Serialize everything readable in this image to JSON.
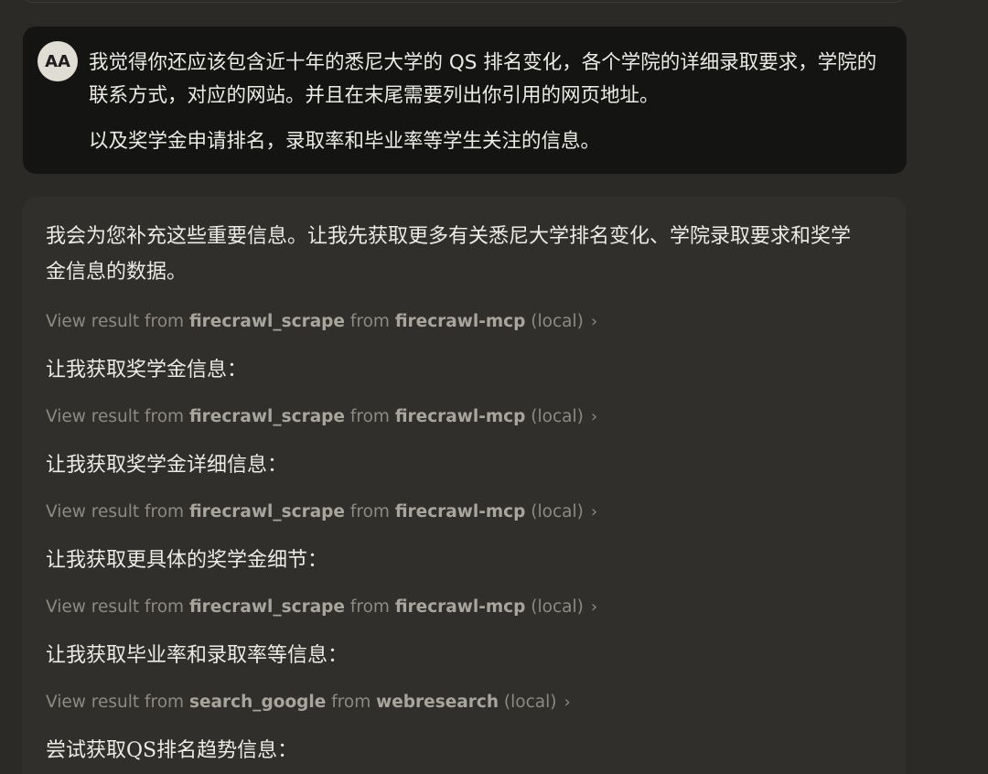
{
  "user_message": {
    "avatar_initials": "AA",
    "paragraphs": [
      "我觉得你还应该包含近十年的悉尼大学的 QS 排名变化，各个学院的详细录取要求，学院的联系方式，对应的网站。并且在末尾需要列出你引用的网页地址。",
      "以及奖学金申请排名，录取率和毕业率等学生关注的信息。"
    ]
  },
  "assistant_message": {
    "intro": "我会为您补充这些重要信息。让我先获取更多有关悉尼大学排名变化、学院录取要求和奖学金信息的数据。",
    "tool_result_prefix": "View result from",
    "tool_result_from": "from",
    "tool_result_suffix": "(local)",
    "steps": [
      {
        "tool": "firecrawl_scrape",
        "server": "firecrawl-mcp",
        "after_text": "让我获取奖学金信息："
      },
      {
        "tool": "firecrawl_scrape",
        "server": "firecrawl-mcp",
        "after_text": "让我获取奖学金详细信息："
      },
      {
        "tool": "firecrawl_scrape",
        "server": "firecrawl-mcp",
        "after_text": "让我获取更具体的奖学金细节："
      },
      {
        "tool": "firecrawl_scrape",
        "server": "firecrawl-mcp",
        "after_text": "让我获取毕业率和录取率等信息："
      },
      {
        "tool": "search_google",
        "server": "webresearch",
        "after_text": "尝试获取QS排名趋势信息："
      }
    ]
  }
}
